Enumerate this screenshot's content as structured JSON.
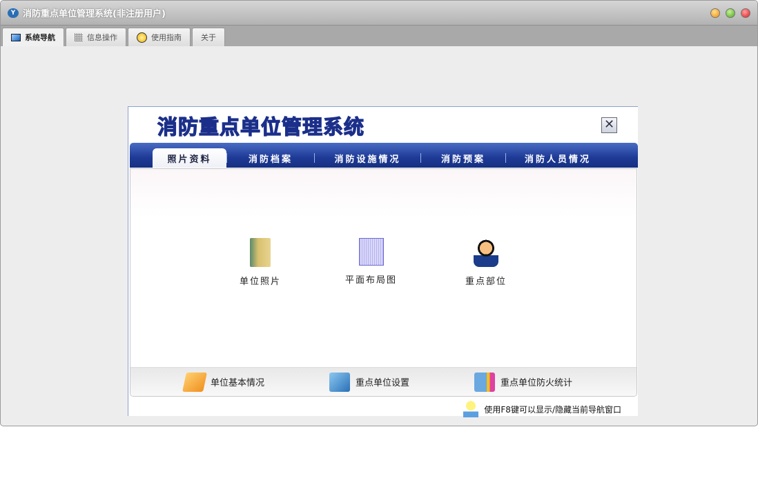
{
  "window": {
    "title": "消防重点单位管理系统(非注册用户)",
    "logo_text": "Y"
  },
  "tabs": [
    {
      "label": "系统导航",
      "icon": "monitor-icon"
    },
    {
      "label": "信息操作",
      "icon": "grid-icon"
    },
    {
      "label": "使用指南",
      "icon": "help-icon"
    },
    {
      "label": "关于"
    }
  ],
  "panel": {
    "banner": "消防重点单位管理系统",
    "close": "✕",
    "nav": [
      "照片资料",
      "消防档案",
      "消防设施情况",
      "消防预案",
      "消防人员情况"
    ],
    "items": [
      {
        "label": "单位照片",
        "icon": "photo-album-icon"
      },
      {
        "label": "平面布局图",
        "icon": "floor-plan-icon"
      },
      {
        "label": "重点部位",
        "icon": "person-icon"
      }
    ],
    "bottom": [
      {
        "label": "单位基本情况",
        "icon": "folder-edit-icon"
      },
      {
        "label": "重点单位设置",
        "icon": "folder-settings-icon"
      },
      {
        "label": "重点单位防火统计",
        "icon": "statistics-icon"
      }
    ],
    "hint": "使用F8键可以显示/隐藏当前导航窗口"
  },
  "colors": {
    "accent": "#1e3a96"
  }
}
